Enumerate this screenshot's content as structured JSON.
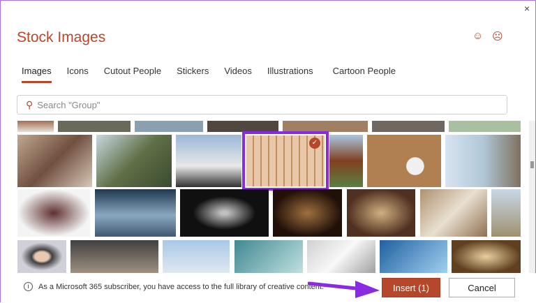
{
  "dialog": {
    "title": "Stock Images",
    "close_label": "×",
    "smile": "☺",
    "frown": "☹"
  },
  "tabs": [
    {
      "label": "Images",
      "active": true
    },
    {
      "label": "Icons"
    },
    {
      "label": "Cutout People"
    },
    {
      "label": "Stickers"
    },
    {
      "label": "Videos"
    },
    {
      "label": "Illustrations"
    },
    {
      "label": "Cartoon People"
    }
  ],
  "search": {
    "placeholder": "Search \"Group\"",
    "value": ""
  },
  "selection": {
    "check": "✓"
  },
  "footer": {
    "info_icon": "i",
    "info_text": "As a Microsoft 365 subscriber, you have access to the full library of creative content.",
    "insert_label": "Insert (1)",
    "cancel_label": "Cancel"
  }
}
